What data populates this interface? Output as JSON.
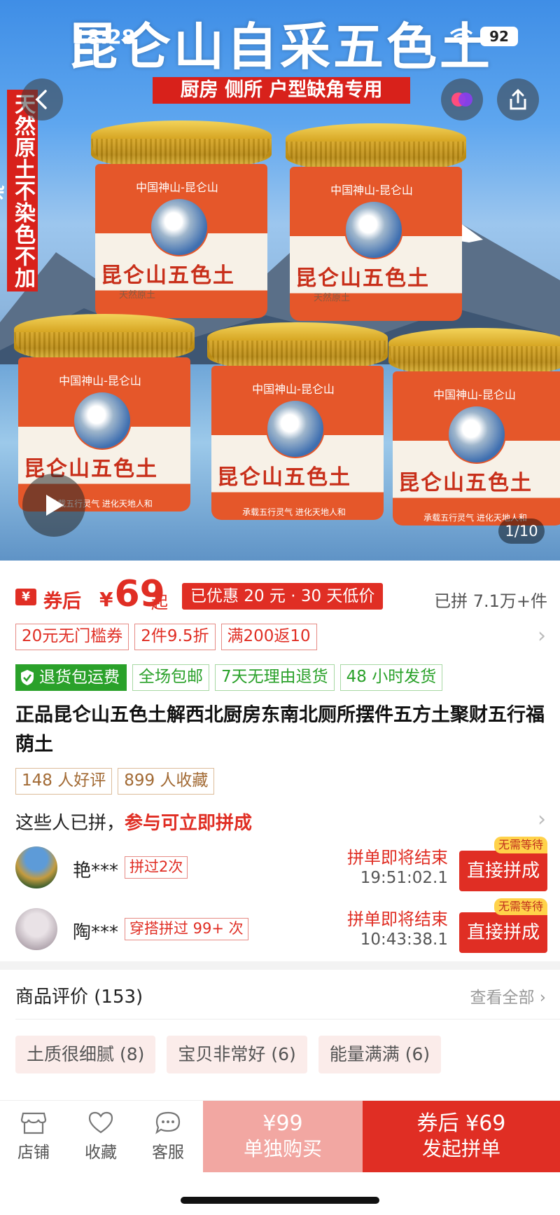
{
  "status": {
    "time": "18:28",
    "battery": "92"
  },
  "hero": {
    "title": "昆仑山自采五色土",
    "banner": "厨房 侧所 户型缺角专用",
    "side_text": "天然原土不染色不加杂",
    "jar_top_text": "中国神山-昆仑山",
    "jar_name": "昆仑山五色土",
    "jar_sub": "天然原土",
    "jar_foot": "承载五行灵气  进化天地人和",
    "pager": "1/10"
  },
  "price": {
    "after_label": "券后",
    "currency": "¥",
    "amount": "69",
    "suffix": "起",
    "promo": "已优惠 20 元 · 30 天低价",
    "sold": "已拼 7.1万+件",
    "coupon_icon": "¥"
  },
  "coupons": [
    "20元无门槛券",
    "2件9.5折",
    "满200返10"
  ],
  "services": {
    "primary": "退货包运费",
    "items": [
      "全场包邮",
      "7天无理由退货",
      "48 小时发货"
    ]
  },
  "product_title": "正品昆仑山五色土解西北厨房东南北厕所摆件五方土聚财五行福荫土",
  "social": [
    "148 人好评",
    "899 人收藏"
  ],
  "join": {
    "prefix": "这些人已拼，",
    "highlight": "参与可立即拼成",
    "groups": [
      {
        "name": "艳***",
        "tag": "拼过2次",
        "ending": "拼单即将结束",
        "timer": "19:51:02.1",
        "button": "直接拼成",
        "badge": "无需等待"
      },
      {
        "name": "陶***",
        "tag": "穿搭拼过 99+ 次",
        "ending": "拼单即将结束",
        "timer": "10:43:38.1",
        "button": "直接拼成",
        "badge": "无需等待"
      }
    ]
  },
  "reviews": {
    "heading": "商品评价 (153)",
    "view_all": "查看全部",
    "chips": [
      "土质很细腻 (8)",
      "宝贝非常好 (6)",
      "能量满满 (6)"
    ]
  },
  "bottom_bar": {
    "shop": "店铺",
    "favorite": "收藏",
    "service": "客服",
    "single_price": "¥99",
    "single_label": "单独购买",
    "group_price": "券后 ¥69",
    "group_label": "发起拼单"
  },
  "colors": {
    "accent": "#e02e24",
    "green": "#2aa12a",
    "brown": "#a26a34"
  }
}
